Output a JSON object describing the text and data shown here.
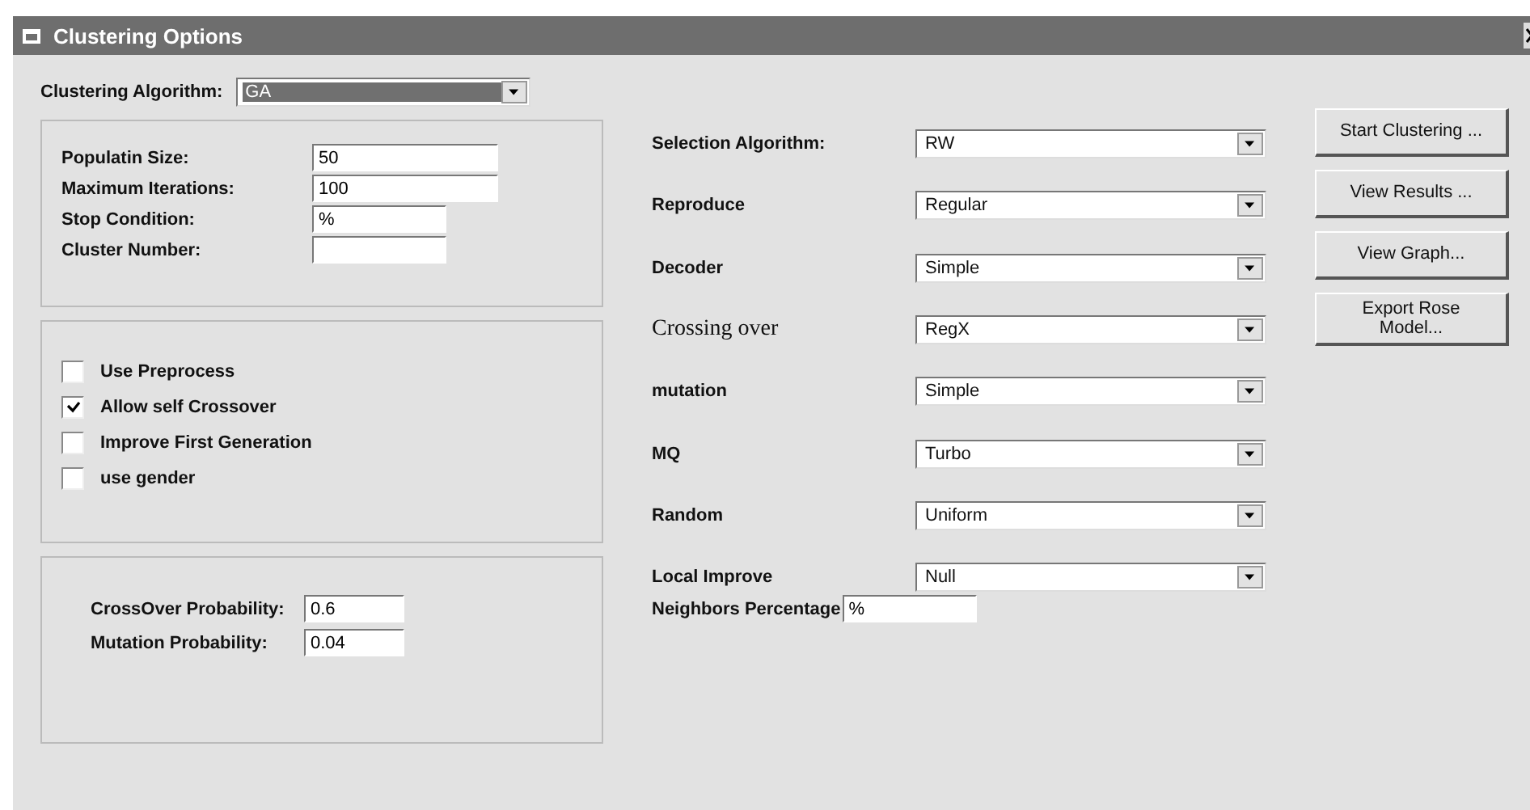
{
  "window": {
    "title": "Clustering Options"
  },
  "algorithm": {
    "label": "Clustering Algorithm:",
    "value": "GA",
    "focused": true
  },
  "parameters": [
    {
      "label": "Populatin Size:",
      "value": "50",
      "wide": true
    },
    {
      "label": "Maximum Iterations:",
      "value": "100",
      "wide": true
    },
    {
      "label": "Stop Condition:",
      "value": "%",
      "wide": false
    },
    {
      "label": "Cluster Number:",
      "wide": false
    }
  ],
  "options": [
    {
      "label": "Use Preprocess",
      "checked": false
    },
    {
      "label": "Allow self Crossover",
      "checked": true
    },
    {
      "label": "Improve First Generation",
      "checked": false
    },
    {
      "label": "use gender",
      "checked": false
    }
  ],
  "probabilities": [
    {
      "label": "CrossOver Probability:",
      "value": "0.6"
    },
    {
      "label": "Mutation Probability:",
      "value": "0.04"
    }
  ],
  "operators": [
    {
      "label": "Selection Algorithm:",
      "value": "RW",
      "kind": "bold"
    },
    {
      "label": "Reproduce",
      "value": "Regular",
      "kind": "bold"
    },
    {
      "label": "Decoder",
      "value": "Simple",
      "kind": "bold"
    },
    {
      "label": "Crossing over",
      "value": "RegX",
      "kind": "serif"
    },
    {
      "label": "mutation",
      "value": "Simple",
      "kind": "bold"
    },
    {
      "label": "MQ",
      "value": "Turbo",
      "kind": "bold"
    },
    {
      "label": "Random",
      "value": "Uniform",
      "kind": "bold"
    },
    {
      "label": "Local Improve",
      "value": "Null",
      "kind": "bold"
    }
  ],
  "neighbors": {
    "label": "Neighbors Percentage",
    "value": "%"
  },
  "buttons": [
    "Start Clustering ...",
    "View Results ...",
    "View Graph...",
    "Export Rose Model..."
  ]
}
